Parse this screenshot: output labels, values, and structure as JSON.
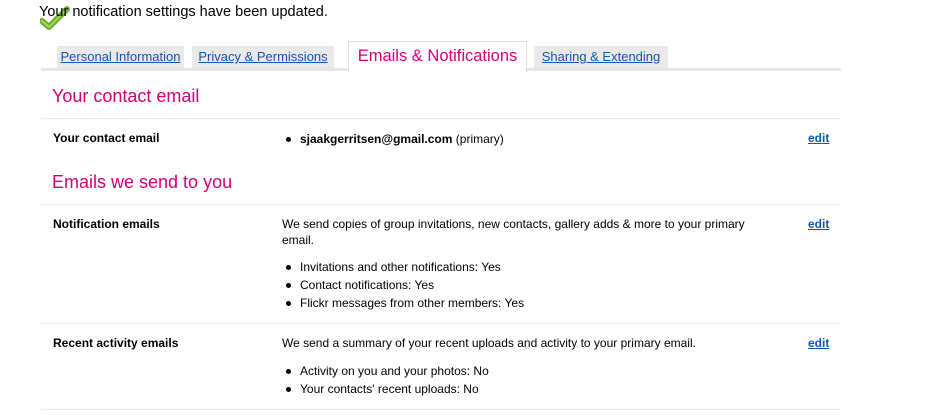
{
  "notice": {
    "icon": "checkmark-icon",
    "text": "Your notification settings have been updated."
  },
  "tabs": [
    {
      "label": "Personal Information",
      "active": false
    },
    {
      "label": "Privacy & Permissions",
      "active": false
    },
    {
      "label": "Emails & Notifications",
      "active": true
    },
    {
      "label": "Sharing & Extending",
      "active": false
    }
  ],
  "contact_section": {
    "title": "Your contact email",
    "row_label": "Your contact email",
    "email": "sjaakgerritsen@gmail.com",
    "email_suffix": "(primary)",
    "edit_label": "edit"
  },
  "emails_section": {
    "title": "Emails we send to you",
    "notification": {
      "label": "Notification emails",
      "description": "We send copies of group invitations, new contacts, gallery adds & more to your primary email.",
      "items": [
        "Invitations and other notifications:  Yes",
        "Contact notifications:  Yes",
        "Flickr messages from other members:  Yes"
      ],
      "edit_label": "edit"
    },
    "activity": {
      "label": "Recent activity emails",
      "description": "We send a summary of your recent uploads and activity to your primary email.",
      "items": [
        "Activity on you and your photos:  No",
        "Your contacts' recent uploads: No"
      ],
      "edit_label": "edit"
    }
  },
  "colors": {
    "accent": "#d40078",
    "link": "#1057a8",
    "check": "#7db83a"
  }
}
